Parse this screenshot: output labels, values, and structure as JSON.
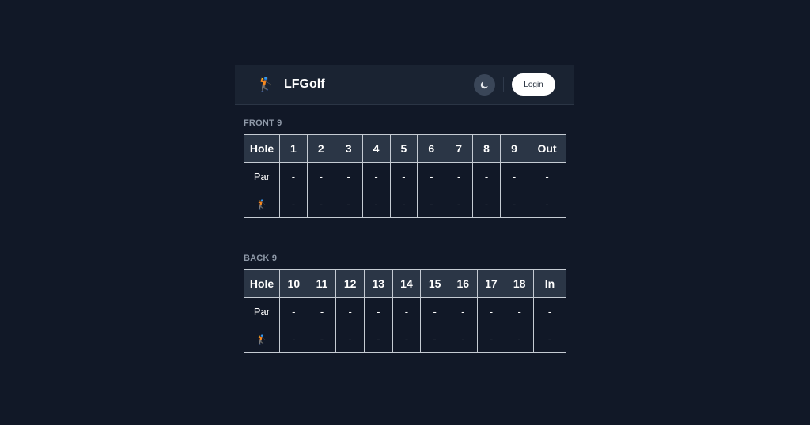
{
  "header": {
    "brand_icon": "golfer-icon",
    "title": "LFGolf",
    "theme_toggle_icon": "moon-icon",
    "login_label": "Login"
  },
  "front": {
    "label": "FRONT 9",
    "headers": [
      "Hole",
      "1",
      "2",
      "3",
      "4",
      "5",
      "6",
      "7",
      "8",
      "9",
      "Out"
    ],
    "par_label": "Par",
    "par": [
      "-",
      "-",
      "-",
      "-",
      "-",
      "-",
      "-",
      "-",
      "-",
      "-"
    ],
    "score_icon": "golfer-icon",
    "score": [
      "-",
      "-",
      "-",
      "-",
      "-",
      "-",
      "-",
      "-",
      "-",
      "-"
    ]
  },
  "back": {
    "label": "BACK 9",
    "headers": [
      "Hole",
      "10",
      "11",
      "12",
      "13",
      "14",
      "15",
      "16",
      "17",
      "18",
      "In"
    ],
    "par_label": "Par",
    "par": [
      "-",
      "-",
      "-",
      "-",
      "-",
      "-",
      "-",
      "-",
      "-",
      "-"
    ],
    "score_icon": "golfer-icon",
    "score": [
      "-",
      "-",
      "-",
      "-",
      "-",
      "-",
      "-",
      "-",
      "-",
      "-"
    ]
  },
  "colors": {
    "background": "#111827",
    "header_bg": "#1a2332",
    "table_head_bg": "#2b3646",
    "border": "#c5cbd3"
  }
}
